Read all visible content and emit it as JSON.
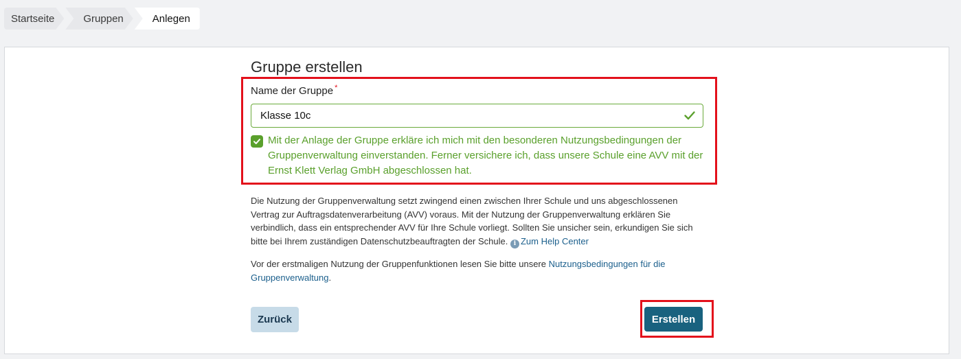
{
  "breadcrumb": {
    "items": [
      "Startseite",
      "Gruppen",
      "Anlegen"
    ]
  },
  "form": {
    "title": "Gruppe erstellen",
    "name_label": "Name der Gruppe",
    "required_marker": "*",
    "name_value": "Klasse 10c",
    "consent_checked": true,
    "consent_text": "Mit der Anlage der Gruppe erkläre ich mich mit den besonderen Nutzungsbedingungen der Gruppenverwaltung einverstanden. Ferner versichere ich, dass unsere Schule eine AVV mit der Ernst Klett Verlag GmbH abgeschlossen hat."
  },
  "info": {
    "text": "Die Nutzung der Gruppenverwaltung setzt zwingend einen zwischen Ihrer Schule und uns abgeschlossenen Vertrag zur Auftragsdatenverarbeitung (AVV) voraus. Mit der Nutzung der Gruppenverwaltung erklären Sie verbindlich, dass ein entsprechender AVV für Ihre Schule vorliegt. Sollten Sie unsicher sein, erkundigen Sie sich bitte bei Ihrem zuständigen Datenschutzbeauftragten der Schule.",
    "info_icon_glyph": "i",
    "help_link": "Zum Help Center"
  },
  "terms": {
    "text_before": "Vor der erstmaligen Nutzung der Gruppenfunktionen lesen Sie bitte unsere ",
    "link": "Nutzungsbedingungen für die Gruppenverwaltung",
    "text_after": "."
  },
  "buttons": {
    "back": "Zurück",
    "create": "Erstellen"
  },
  "colors": {
    "success_green": "#5aa02c",
    "primary_button": "#19627f",
    "secondary_button": "#c7dbe8",
    "highlight_red": "#e3101b",
    "link": "#1b5f8c"
  },
  "icons": {
    "input_status": "check-icon",
    "checkbox": "checkmark-icon",
    "help": "info-icon"
  }
}
